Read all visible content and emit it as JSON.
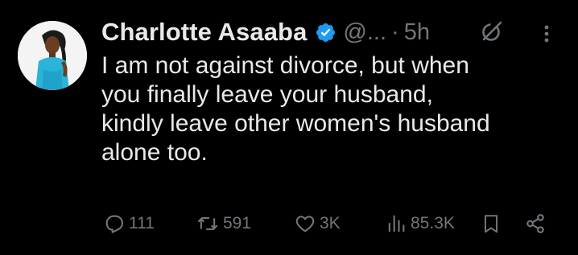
{
  "tweet": {
    "author_name": "Charlotte Asaaba",
    "handle": "@...",
    "separator": "·",
    "time": "5h",
    "text_lines": [
      "I am not against divorce, but when",
      "you finally leave your husband,",
      "kindly leave other women's husband",
      "alone too."
    ]
  },
  "actions": {
    "replies": "111",
    "reposts": "591",
    "likes": "3K",
    "views": "85.3K"
  },
  "icons": {
    "verified": "verified-badge-icon",
    "grok": "grok-icon",
    "more": "more-vertical-icon",
    "reply": "reply-icon",
    "repost": "repost-icon",
    "like": "heart-icon",
    "views": "analytics-icon",
    "bookmark": "bookmark-icon",
    "share": "share-icon"
  },
  "colors": {
    "background": "#000000",
    "text": "#e7e9ea",
    "secondary": "#71767b",
    "verified": "#1d9bf0"
  }
}
